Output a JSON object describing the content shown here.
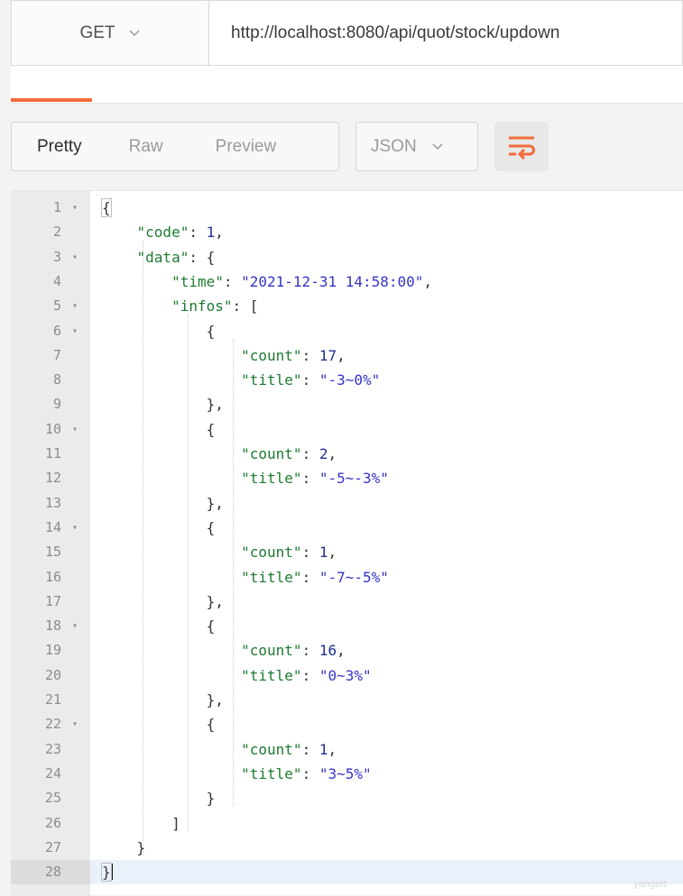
{
  "request": {
    "method": "GET",
    "url": "http://localhost:8080/api/quot/stock/updown"
  },
  "response_toolbar": {
    "view_modes": [
      "Pretty",
      "Raw",
      "Preview"
    ],
    "active_view": "Pretty",
    "format": "JSON",
    "wrap_icon": "wrap-lines-icon"
  },
  "editor": {
    "current_line": 28,
    "lines": [
      {
        "n": "1",
        "fold": true
      },
      {
        "n": "2",
        "fold": false
      },
      {
        "n": "3",
        "fold": true
      },
      {
        "n": "4",
        "fold": false
      },
      {
        "n": "5",
        "fold": true
      },
      {
        "n": "6",
        "fold": true
      },
      {
        "n": "7",
        "fold": false
      },
      {
        "n": "8",
        "fold": false
      },
      {
        "n": "9",
        "fold": false
      },
      {
        "n": "10",
        "fold": true
      },
      {
        "n": "11",
        "fold": false
      },
      {
        "n": "12",
        "fold": false
      },
      {
        "n": "13",
        "fold": false
      },
      {
        "n": "14",
        "fold": true
      },
      {
        "n": "15",
        "fold": false
      },
      {
        "n": "16",
        "fold": false
      },
      {
        "n": "17",
        "fold": false
      },
      {
        "n": "18",
        "fold": true
      },
      {
        "n": "19",
        "fold": false
      },
      {
        "n": "20",
        "fold": false
      },
      {
        "n": "21",
        "fold": false
      },
      {
        "n": "22",
        "fold": true
      },
      {
        "n": "23",
        "fold": false
      },
      {
        "n": "24",
        "fold": false
      },
      {
        "n": "25",
        "fold": false
      },
      {
        "n": "26",
        "fold": false
      },
      {
        "n": "27",
        "fold": false
      },
      {
        "n": "28",
        "fold": false
      }
    ],
    "json_text": {
      "l1": "{",
      "code_key": "\"code\"",
      "code_val": "1",
      "data_key": "\"data\"",
      "time_key": "\"time\"",
      "time_val": "\"2021-12-31 14:58:00\"",
      "infos_key": "\"infos\"",
      "count_key": "\"count\"",
      "title_key": "\"title\"",
      "c1": "17",
      "t1": "\"-3~0%\"",
      "c2": "2",
      "t2": "\"-5~-3%\"",
      "c3": "1",
      "t3": "\"-7~-5%\"",
      "c4": "16",
      "t4": "\"0~3%\"",
      "c5": "1",
      "t5": "\"3~5%\"",
      "l28": "}"
    }
  },
  "watermark": "yangert"
}
